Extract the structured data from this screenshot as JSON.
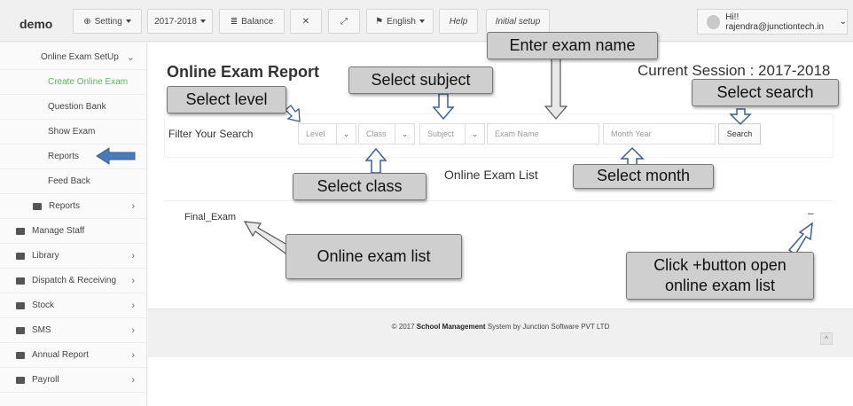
{
  "topbar": {
    "brand": "demo",
    "setting": "Setting",
    "session": "2017-2018",
    "balance": "Balance",
    "expand_icon": "expand-icon",
    "fullscreen_icon": "fullscreen-icon",
    "language": "English",
    "help": "Help",
    "initial_setup": "Initial setup",
    "user": "Hi!! rajendra@junctiontech.in"
  },
  "sidebar": {
    "items": [
      {
        "label": "Online Exam SetUp",
        "icon": "",
        "chevron": "⌄"
      },
      {
        "label": "Create Online Exam"
      },
      {
        "label": "Question Bank"
      },
      {
        "label": "Show Exam"
      },
      {
        "label": "Reports"
      },
      {
        "label": "Feed Back"
      },
      {
        "label": "Reports",
        "icon": "chart-icon",
        "chevron": "›"
      },
      {
        "label": "Manage Staff",
        "icon": "users-icon"
      },
      {
        "label": "Library",
        "icon": "book-icon",
        "chevron": "›"
      },
      {
        "label": "Dispatch & Receiving",
        "icon": "exchange-icon",
        "chevron": "›"
      },
      {
        "label": "Stock",
        "icon": "cart-icon",
        "chevron": "›"
      },
      {
        "label": "SMS",
        "icon": "envelope-icon",
        "chevron": "›"
      },
      {
        "label": "Annual Report",
        "icon": "cart-icon",
        "chevron": "›"
      },
      {
        "label": "Payroll",
        "icon": "cart-icon",
        "chevron": "›"
      }
    ]
  },
  "main": {
    "title": "Online Exam Report",
    "current_session": "Current Session : 2017-2018",
    "filter_label": "Filter Your Search",
    "level": "Level",
    "class": "Class",
    "subject": "Subject",
    "exam_name_placeholder": "Exam Name",
    "month_year_placeholder": "Month Year",
    "search": "Search",
    "list_title": "Online Exam List",
    "exam_row": "Final_Exam",
    "toggle": "–"
  },
  "footer": {
    "prefix": "© 2017",
    "brand": "School Management",
    "suffix": "System by Junction Software PVT LTD",
    "scrolltop": "^"
  },
  "callouts": {
    "enter_exam_name": "Enter exam name",
    "select_subject": "Select subject",
    "select_level": "Select level",
    "select_search": "Select search",
    "select_class": "Select class",
    "select_month": "Select month",
    "online_exam_list": "Online exam list",
    "click_plus_line1": "Click +button open",
    "click_plus_line2": "online exam list"
  },
  "colors": {
    "active_green": "#5cb85c",
    "arrow_blue": "#4a7ab8",
    "callout_bg": "#cfcfcf"
  }
}
